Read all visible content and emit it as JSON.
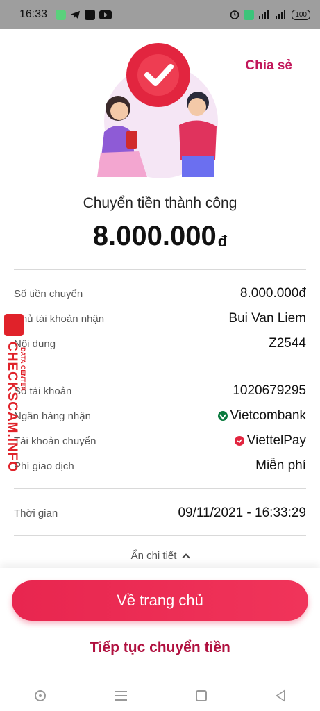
{
  "status_bar": {
    "time": "16:33",
    "battery": "100"
  },
  "header": {
    "share_label": "Chia sẻ"
  },
  "result": {
    "title": "Chuyển tiền thành công",
    "amount": "8.000.000",
    "currency": "đ"
  },
  "details_a": [
    {
      "label": "Số tiền chuyển",
      "value": "8.000.000đ"
    },
    {
      "label": "Chủ tài khoản nhận",
      "value": "Bui Van Liem"
    },
    {
      "label": "Nội dung",
      "value": "Z2544"
    }
  ],
  "details_b": [
    {
      "label": "Số tài khoản",
      "value": "1020679295"
    },
    {
      "label": "Ngân hàng nhận",
      "value": "Vietcombank"
    },
    {
      "label": "Tài khoản chuyển",
      "value": "ViettelPay"
    },
    {
      "label": "Phí giao dịch",
      "value": "Miễn phí"
    }
  ],
  "time_row": {
    "label": "Thời gian",
    "value": "09/11/2021 - 16:33:29"
  },
  "hide_detail_label": "Ẩn chi tiết",
  "actions": {
    "home_label": "Về trang chủ",
    "continue_label": "Tiếp tục chuyển tiền"
  },
  "watermark": {
    "brand": "CHECKSCAM.INFO",
    "sub": "DATA CENTER"
  },
  "colors": {
    "accent": "#e8264f",
    "link": "#b0103f",
    "share": "#c2185b"
  }
}
